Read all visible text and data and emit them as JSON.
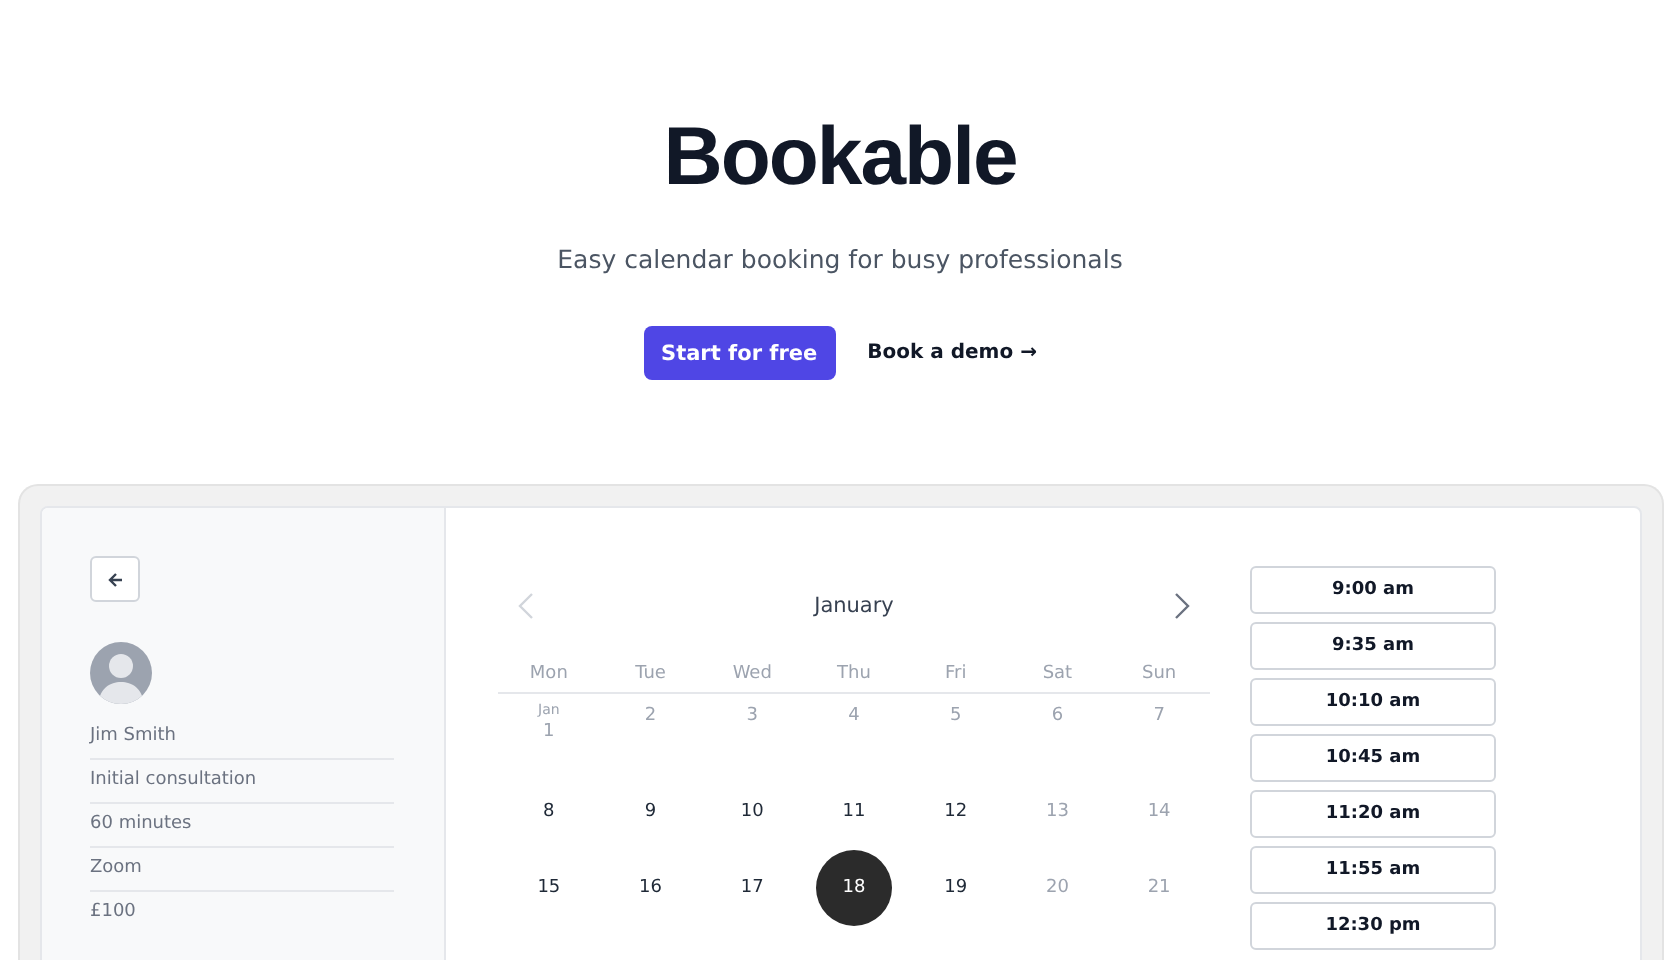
{
  "hero": {
    "title": "Bookable",
    "subtitle": "Easy calendar booking for busy professionals",
    "primary_button": "Start for free",
    "secondary_link": "Book a demo →"
  },
  "sidebar": {
    "details": [
      "Jim Smith",
      "Initial consultation",
      "60 minutes",
      "Zoom",
      "£100"
    ]
  },
  "calendar": {
    "month": "January",
    "prev_disabled": true,
    "next_disabled": false,
    "weekdays": [
      "Mon",
      "Tue",
      "Wed",
      "Thu",
      "Fri",
      "Sat",
      "Sun"
    ],
    "weeks": [
      [
        {
          "label": "1",
          "month": "Jan",
          "disabled": true,
          "selected": false
        },
        {
          "label": "2",
          "disabled": true,
          "selected": false
        },
        {
          "label": "3",
          "disabled": true,
          "selected": false
        },
        {
          "label": "4",
          "disabled": true,
          "selected": false
        },
        {
          "label": "5",
          "disabled": true,
          "selected": false
        },
        {
          "label": "6",
          "disabled": true,
          "selected": false
        },
        {
          "label": "7",
          "disabled": true,
          "selected": false
        }
      ],
      [
        {
          "label": "8",
          "disabled": false,
          "selected": false
        },
        {
          "label": "9",
          "disabled": false,
          "selected": false
        },
        {
          "label": "10",
          "disabled": false,
          "selected": false
        },
        {
          "label": "11",
          "disabled": false,
          "selected": false
        },
        {
          "label": "12",
          "disabled": false,
          "selected": false
        },
        {
          "label": "13",
          "disabled": true,
          "selected": false
        },
        {
          "label": "14",
          "disabled": true,
          "selected": false
        }
      ],
      [
        {
          "label": "15",
          "disabled": false,
          "selected": false
        },
        {
          "label": "16",
          "disabled": false,
          "selected": false
        },
        {
          "label": "17",
          "disabled": false,
          "selected": false
        },
        {
          "label": "18",
          "disabled": false,
          "selected": true
        },
        {
          "label": "19",
          "disabled": false,
          "selected": false
        },
        {
          "label": "20",
          "disabled": true,
          "selected": false
        },
        {
          "label": "21",
          "disabled": true,
          "selected": false
        }
      ]
    ]
  },
  "times": [
    "9:00 am",
    "9:35 am",
    "10:10 am",
    "10:45 am",
    "11:20 am",
    "11:55 am",
    "12:30 pm"
  ]
}
